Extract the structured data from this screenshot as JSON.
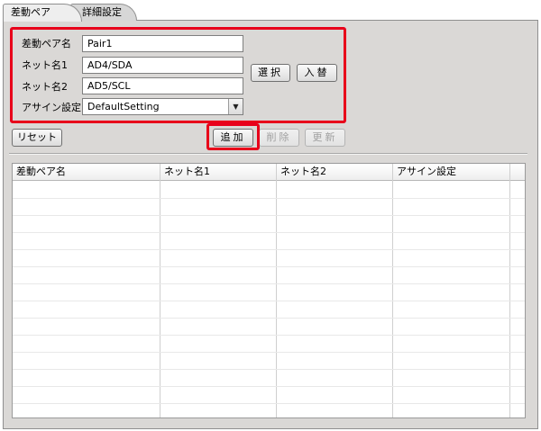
{
  "tabs": [
    {
      "label": "差動ペア",
      "active": true
    },
    {
      "label": "詳細設定",
      "active": false
    }
  ],
  "form": {
    "pair_name": {
      "label": "差動ペア名",
      "value": "Pair1"
    },
    "net1": {
      "label": "ネット名1",
      "value": "AD4/SDA"
    },
    "net2": {
      "label": "ネット名2",
      "value": "AD5/SCL"
    },
    "assign": {
      "label": "アサイン設定",
      "value": "DefaultSetting"
    }
  },
  "buttons": {
    "select": "選択",
    "swap": "入替",
    "reset": "リセット",
    "add": "追加",
    "delete": "削除",
    "update": "更新"
  },
  "table": {
    "columns": [
      "差動ペア名",
      "ネット名1",
      "ネット名2",
      "アサイン設定"
    ]
  },
  "colors": {
    "highlight": "#e8001a",
    "panel": "#dad8d6"
  }
}
